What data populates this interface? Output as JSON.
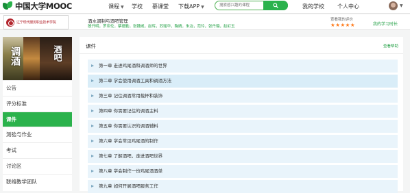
{
  "site": {
    "name": "中国大学MOOC"
  },
  "nav": {
    "course": "课程",
    "school": "学校",
    "classroom": "慕课堂",
    "download": "下载APP",
    "my_school": "我的学校",
    "personal_center": "个人中心"
  },
  "search": {
    "placeholder": "搜索感兴趣的课程"
  },
  "school": {
    "name": "辽宁现代服务职业技术学院"
  },
  "course": {
    "title": "酒水调制与酒吧管理",
    "teachers": "殷开明，罗亚伦，蔡德勤，张魏威，赵晖，苏瑶华，鞠婧，朱冶，范玲，张丹璐，赵虹玉"
  },
  "rating": {
    "label": "查看我的评价",
    "stars": "★★★★★",
    "value": 5
  },
  "study_time_link": "我的学习时长",
  "cover": {
    "text_left": "调酒",
    "text_right": "酒吧"
  },
  "sidebar": {
    "items": [
      {
        "label": "公告",
        "active": false
      },
      {
        "label": "评分标准",
        "active": false
      },
      {
        "label": "课件",
        "active": true
      },
      {
        "label": "测验与作业",
        "active": false
      },
      {
        "label": "考试",
        "active": false
      },
      {
        "label": "讨论区",
        "active": false
      },
      {
        "label": "联络教学团队",
        "active": false
      }
    ]
  },
  "content": {
    "title": "课件",
    "help": "查看帮助",
    "chapters": [
      "第一章 走进鸡尾酒和调酒师的世界",
      "第二章 学会使用调酒工具和调酒方法",
      "第三章 记住调酒常用载杯和装饰",
      "第四章 你需要记住的调酒主料",
      "第五章 你需要认识的调酒辅料",
      "第六章 学会常见鸡尾酒的制作",
      "第七章 了解酒吧，走进酒吧世界",
      "第八章 学会制作一份鸡尾酒酒单",
      "第九章 如何开展酒吧服务工作"
    ]
  },
  "colors": {
    "accent": "#2bb24c",
    "link": "#27a249",
    "star": "#ff7a1a",
    "chapter_bg": "#e9f4fb"
  }
}
